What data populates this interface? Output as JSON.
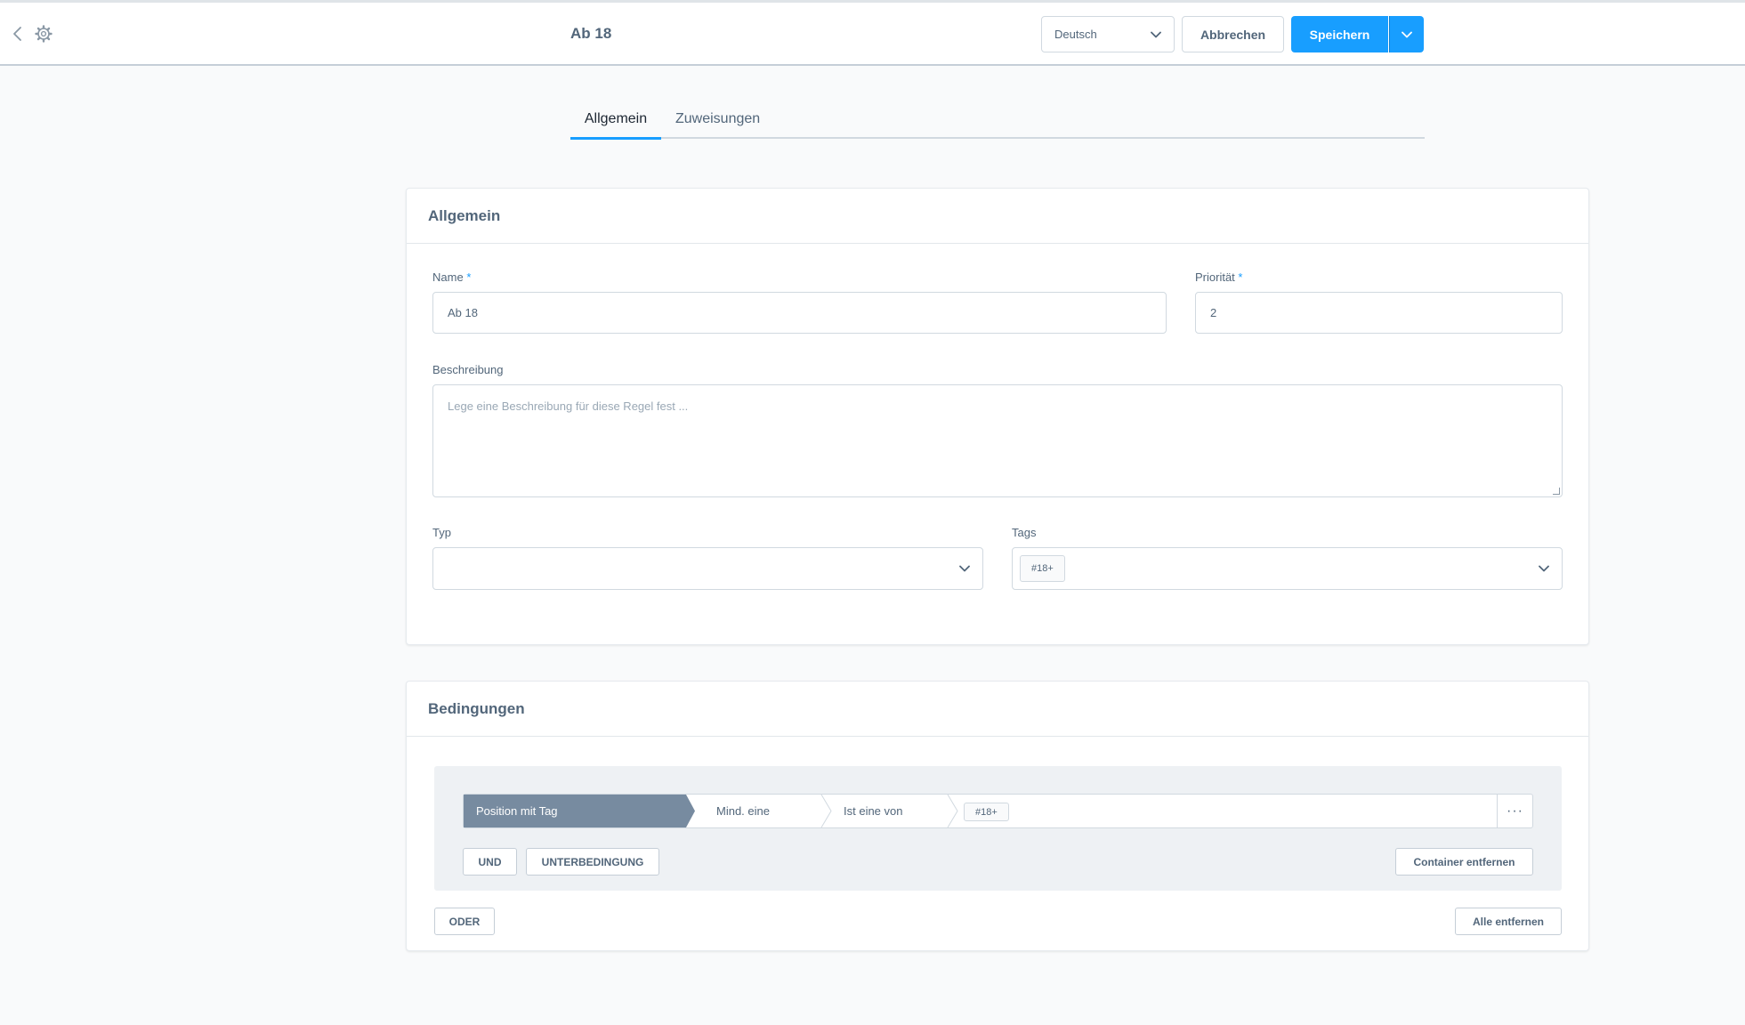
{
  "header": {
    "title": "Ab 18",
    "language": "Deutsch",
    "cancel_label": "Abbrechen",
    "save_label": "Speichern"
  },
  "tabs": [
    {
      "label": "Allgemein",
      "active": true
    },
    {
      "label": "Zuweisungen",
      "active": false
    }
  ],
  "general": {
    "title": "Allgemein",
    "name_label": "Name",
    "name_value": "Ab 18",
    "priority_label": "Priorität",
    "priority_value": "2",
    "required_marker": "*",
    "description_label": "Beschreibung",
    "description_placeholder": "Lege eine Beschreibung für diese Regel fest ...",
    "type_label": "Typ",
    "type_value": "",
    "tags_label": "Tags",
    "tags": [
      "#18+"
    ]
  },
  "conditions": {
    "title": "Bedingungen",
    "field": "Position mit Tag",
    "quantifier": "Mind. eine",
    "operator": "Ist eine von",
    "values": [
      "#18+"
    ],
    "more_label": "···",
    "and_label": "UND",
    "subcondition_label": "UNTERBEDINGUNG",
    "remove_container_label": "Container entfernen",
    "or_label": "ODER",
    "remove_all_label": "Alle entfernen"
  },
  "colors": {
    "primary": "#189eff",
    "text": "#52667a",
    "condition_field_bg": "#778ba0",
    "page_bg": "#f9fafb"
  },
  "icons": {
    "back": "chevron-left-icon",
    "settings": "gear-icon",
    "dropdown": "chevron-down-icon"
  }
}
